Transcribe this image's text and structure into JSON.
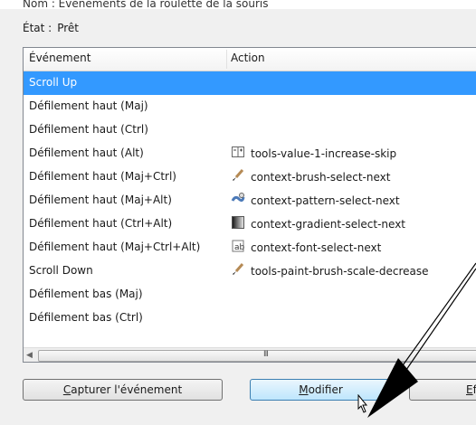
{
  "name_line": "Nom : Événements de la roulette de la souris",
  "state": {
    "label": "État :",
    "value": "Prêt"
  },
  "columns": {
    "event": "Événement",
    "action": "Action"
  },
  "rows": [
    {
      "event": "Scroll Up",
      "action": "",
      "icon": "",
      "selected": true
    },
    {
      "event": "Défilement haut (Maj)",
      "action": "",
      "icon": ""
    },
    {
      "event": "Défilement haut (Ctrl)",
      "action": "",
      "icon": ""
    },
    {
      "event": "Défilement haut (Alt)",
      "action": "tools-value-1-increase-skip",
      "icon": "value-icon"
    },
    {
      "event": "Défilement haut (Maj+Ctrl)",
      "action": "context-brush-select-next",
      "icon": "brush-icon"
    },
    {
      "event": "Défilement haut (Maj+Alt)",
      "action": "context-pattern-select-next",
      "icon": "pattern-icon"
    },
    {
      "event": "Défilement haut (Ctrl+Alt)",
      "action": "context-gradient-select-next",
      "icon": "gradient-icon"
    },
    {
      "event": "Défilement haut (Maj+Ctrl+Alt)",
      "action": "context-font-select-next",
      "icon": "font-icon"
    },
    {
      "event": "Scroll Down",
      "action": "tools-paint-brush-scale-decrease",
      "icon": "brush-icon"
    },
    {
      "event": "Défilement bas (Maj)",
      "action": "",
      "icon": ""
    },
    {
      "event": "Défilement bas (Ctrl)",
      "action": "",
      "icon": ""
    }
  ],
  "buttons": {
    "capture": {
      "first": "C",
      "rest": "apturer l'événement"
    },
    "modify": {
      "first": "M",
      "rest": "odifier"
    },
    "erase": {
      "first": "E",
      "rest": "ffa"
    }
  },
  "scrollbar_grip": "III",
  "colors": {
    "selection": "#3399ff",
    "hover_button": "#bee6fd"
  }
}
